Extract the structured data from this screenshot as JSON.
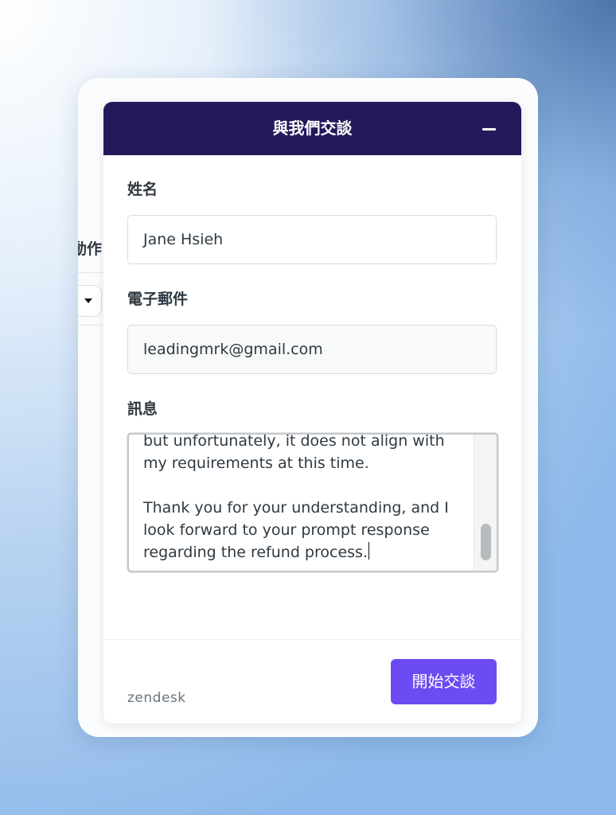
{
  "widget": {
    "title": "與我們交談",
    "minimize_icon": "minimize-icon",
    "form": {
      "name_label": "姓名",
      "name_value": "Jane Hsieh",
      "email_label": "電子郵件",
      "email_value": "leadingmrk@gmail.com",
      "message_label": "訊息",
      "message_value": "but unfortunately, it does not align with\nmy requirements at this time.\n\nThank you for your understanding, and I\nlook forward to your prompt response\nregarding the refund process."
    },
    "footer": {
      "brand": "zendesk",
      "start_button": "開始交談"
    },
    "colors": {
      "header_bg": "#231a5b",
      "button_bg": "#6d4bf2"
    }
  },
  "background_page": {
    "partial_label": "動作",
    "dropdown_icon": "caret-down-icon"
  }
}
